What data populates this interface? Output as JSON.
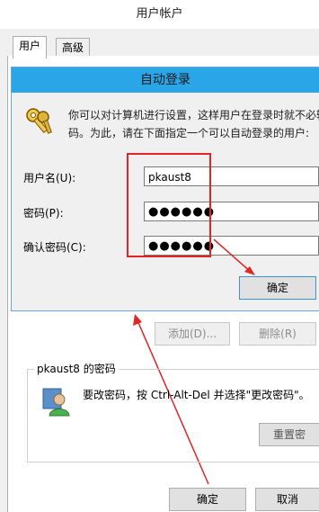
{
  "window": {
    "title": "用户帐户"
  },
  "tabs": [
    {
      "label": "用户"
    },
    {
      "label": "高级"
    }
  ],
  "dialog": {
    "title": "自动登录",
    "description_line1": "你可以对计算机进行设置，这样用户在登录时就不必输",
    "description_line2": "码。为此，请在下面指定一个可以自动登录的用户:",
    "username_label": "用户名(U):",
    "username_value": "pkaust8",
    "password_label": "密码(P):",
    "password_value": "●●●●●●",
    "confirm_label": "确认密码(C):",
    "confirm_value": "●●●●●●",
    "ok_button": "确定"
  },
  "user_actions": {
    "add_button": "添加(D)...",
    "remove_button": "删除(R)"
  },
  "password_group": {
    "title": "pkaust8 的密码",
    "text": "要改密码，按 Ctrl-Alt-Del 并选择\"更改密码\"。",
    "reset_button": "重置密"
  },
  "footer": {
    "ok_button": "确定",
    "cancel_button": "取消"
  },
  "colors": {
    "title_bar": "#29a5e8",
    "annotation": "#e02525"
  },
  "icons": {
    "key": "key-icon",
    "user": "user-icon"
  }
}
